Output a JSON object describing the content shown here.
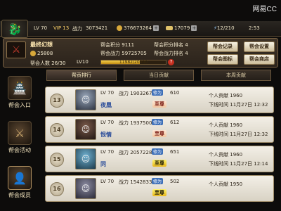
{
  "watermark": "网易CC",
  "topbar": {
    "level": "LV 70",
    "vip": "VIP 13",
    "power_label": "战力",
    "power": "3073421",
    "coins": "376673264",
    "ingots": "17079",
    "stamina": "12/210",
    "time": "2:53"
  },
  "guild": {
    "name": "最终幻想",
    "funds": "25808",
    "member_label": "帮会人数",
    "members": "26/30",
    "points_label": "帮会积分",
    "points": "9111",
    "power_label": "帮会战力",
    "power": "59725705",
    "points_rank_label": "帮会积分排名",
    "points_rank": "4",
    "power_rank_label": "帮会战力排名",
    "power_rank": "4",
    "level": "LV10",
    "exp_text": "11982/20000",
    "exp_progress": 0.6,
    "help": "?"
  },
  "guild_buttons": [
    "帮会记录",
    "帮会设置",
    "帮会图标",
    "帮会商店"
  ],
  "leftnav": [
    {
      "label": "帮会入口",
      "icon": "guild-hall-icon"
    },
    {
      "label": "帮会活动",
      "icon": "guild-event-icon"
    },
    {
      "label": "帮会成员",
      "icon": "guild-member-icon"
    }
  ],
  "tabs": [
    "帮贡排行",
    "当日贡献",
    "本周贡献"
  ],
  "members": [
    {
      "rank": "13",
      "lv": "LV 70",
      "power_label": "战力",
      "power": "1903267",
      "rep_label": "修为",
      "rep": "610",
      "name": "夜凰",
      "title": "至尊",
      "title_color": "a",
      "contrib_label": "个人贡献",
      "contrib": "1960",
      "login_label": "下线时间",
      "login": "11月27日 12:32"
    },
    {
      "rank": "14",
      "lv": "LV 70",
      "power_label": "战力",
      "power": "1937500",
      "rep_label": "修为",
      "rep": "612",
      "name": "恨情",
      "title": "至尊",
      "title_color": "a",
      "contrib_label": "个人贡献",
      "contrib": "1960",
      "login_label": "下线时间",
      "login": "11月27日 12:32"
    },
    {
      "rank": "15",
      "lv": "LV 70",
      "power_label": "战力",
      "power": "2057228",
      "rep_label": "修为",
      "rep": "651",
      "name": "同",
      "title": "至尊",
      "title_color": "b",
      "contrib_label": "个人贡献",
      "contrib": "1960",
      "login_label": "下线时间",
      "login": "11月27日 12:14"
    },
    {
      "rank": "16",
      "lv": "LV 70",
      "power_label": "战力",
      "power": "1542833",
      "rep_label": "修为",
      "rep": "502",
      "name": "",
      "title": "至尊",
      "title_color": "b",
      "contrib_label": "个人贡献",
      "contrib": "1950",
      "login_label": "",
      "login": ""
    }
  ]
}
